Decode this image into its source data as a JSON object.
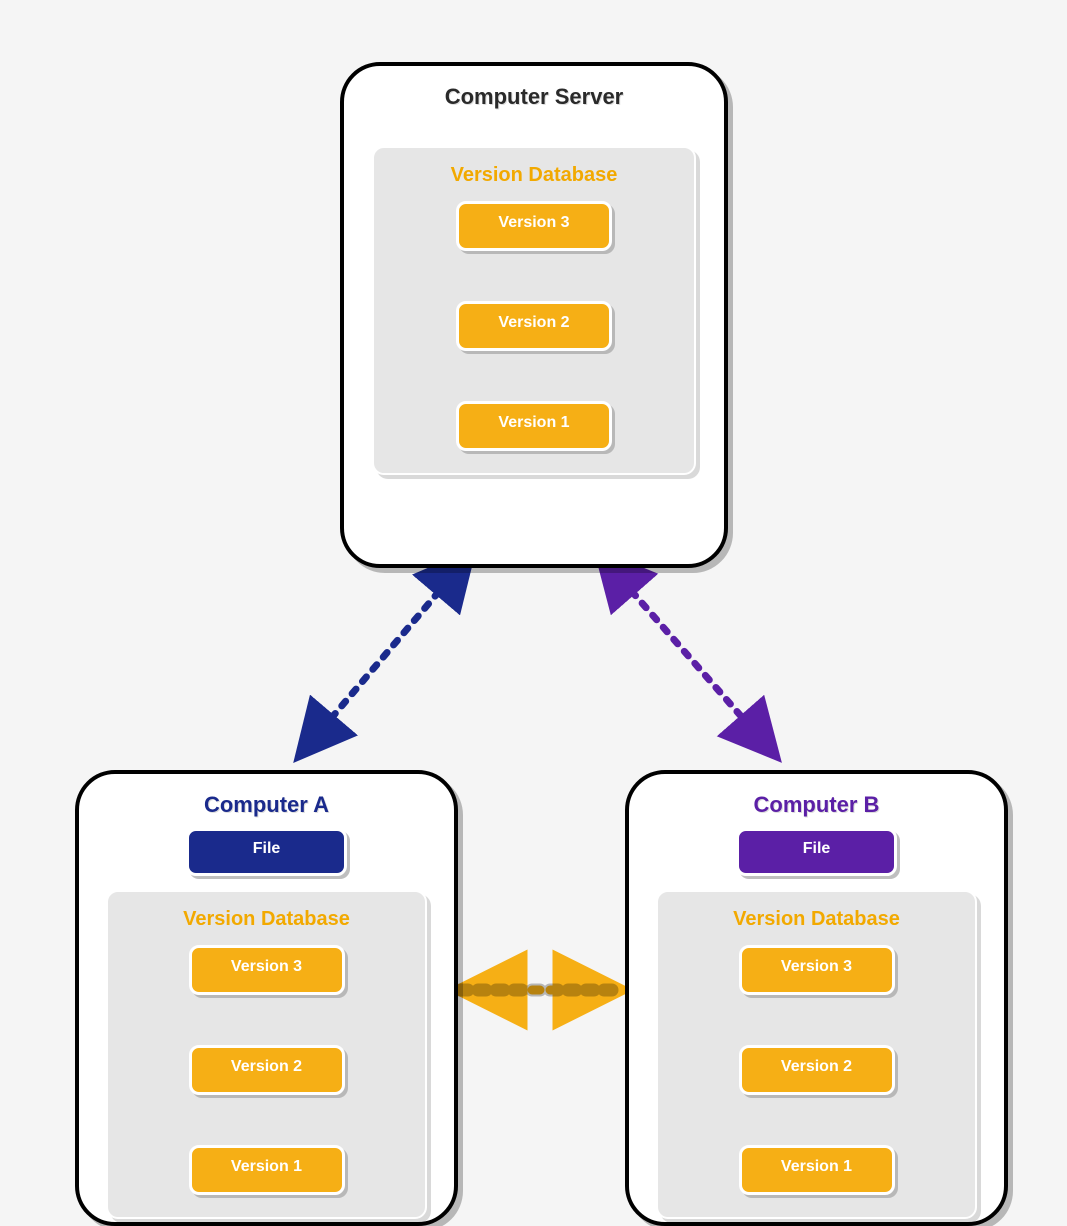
{
  "server": {
    "title": "Computer Server",
    "db_title": "Version Database",
    "versions": [
      "Version 3",
      "Version 2",
      "Version 1"
    ]
  },
  "computerA": {
    "title": "Computer A",
    "file_label": "File",
    "db_title": "Version Database",
    "versions": [
      "Version 3",
      "Version 2",
      "Version 1"
    ]
  },
  "computerB": {
    "title": "Computer B",
    "file_label": "File",
    "db_title": "Version Database",
    "versions": [
      "Version 3",
      "Version 2",
      "Version 1"
    ]
  },
  "colors": {
    "version_box": "#f6af15",
    "file_a": "#1a2a8c",
    "file_b": "#5b1fa6",
    "arrow_server_a": "#1a2a8c",
    "arrow_server_b": "#5b1fa6",
    "arrow_a_b": "#f6af15"
  }
}
